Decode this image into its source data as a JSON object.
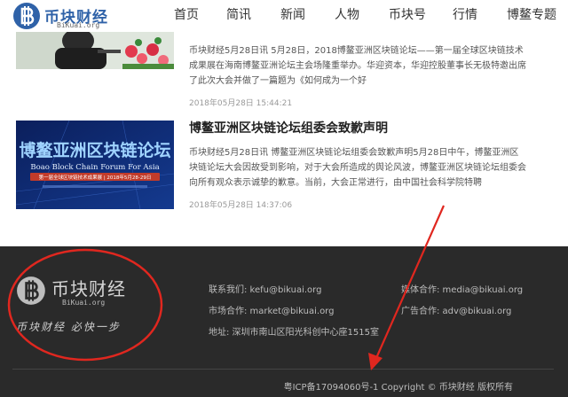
{
  "header": {
    "logo_text": "币块财经",
    "logo_sub": "BiKuai.org",
    "nav": [
      "首页",
      "简讯",
      "新闻",
      "人物",
      "币块号",
      "行情",
      "博鳌专题"
    ]
  },
  "articles": [
    {
      "summary": "币块财经5月28日讯 5月28日，2018博鳌亚洲区块链论坛——第一届全球区块链技术成果展在海南博鳌亚洲论坛主会场隆重举办。华迎资本，华迎控股董事长无极特邀出席了此次大会并做了一篇题为《如何成为一个好",
      "date": "2018年05月28日 15:44:21"
    },
    {
      "title": "博鳌亚洲区块链论坛组委会致歉声明",
      "summary": "币块财经5月28日讯 博鳌亚洲区块链论坛组委会致歉声明5月28日中午，博鳌亚洲区块链论坛大会因故受到影响，对于大会所造成的舆论风波，博鳌亚洲区块链论坛组委会向所有观众表示诚挚的歉意。当前，大会正常进行，由中国社会科学院特聘",
      "date": "2018年05月28日 14:37:06",
      "banner_title": "博鳌亚洲区块链论坛",
      "banner_en": "Boao Block Chain Forum For Asia",
      "banner_sub": "第一届全球区块链技术成果展 | 2018年5月28-29日"
    }
  ],
  "footer": {
    "logo_text": "币块财经",
    "logo_sub": "BiKuai.org",
    "slogan": "币块财经  必快一步",
    "contact_us": "联系我们: kefu@bikuai.org",
    "media": "媒体合作: media@bikuai.org",
    "market": "市场合作: market@bikuai.org",
    "ads": "广告合作: adv@bikuai.org",
    "address": "地址: 深圳市南山区阳光科创中心座1515室",
    "copyright": "粤ICP备17094060号-1 Copyright © 币块财经 版权所有"
  },
  "colors": {
    "brand_blue": "#2f62a8",
    "footer_bg": "#2a2a2a",
    "annotation_red": "#e0271f",
    "banner_bg": "#0e2a72"
  }
}
